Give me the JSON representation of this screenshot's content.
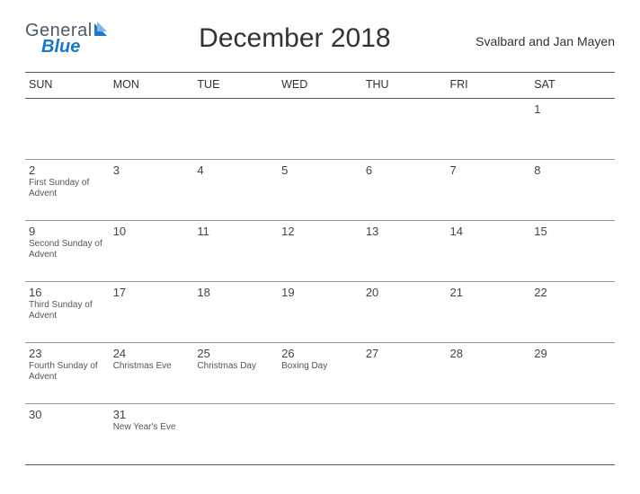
{
  "logo": {
    "word1": "General",
    "word2": "Blue"
  },
  "title": "December 2018",
  "region": "Svalbard and Jan Mayen",
  "dow": [
    "SUN",
    "MON",
    "TUE",
    "WED",
    "THU",
    "FRI",
    "SAT"
  ],
  "weeks": [
    [
      {
        "n": "",
        "e": ""
      },
      {
        "n": "",
        "e": ""
      },
      {
        "n": "",
        "e": ""
      },
      {
        "n": "",
        "e": ""
      },
      {
        "n": "",
        "e": ""
      },
      {
        "n": "",
        "e": ""
      },
      {
        "n": "1",
        "e": ""
      }
    ],
    [
      {
        "n": "2",
        "e": "First Sunday of Advent"
      },
      {
        "n": "3",
        "e": ""
      },
      {
        "n": "4",
        "e": ""
      },
      {
        "n": "5",
        "e": ""
      },
      {
        "n": "6",
        "e": ""
      },
      {
        "n": "7",
        "e": ""
      },
      {
        "n": "8",
        "e": ""
      }
    ],
    [
      {
        "n": "9",
        "e": "Second Sunday of Advent"
      },
      {
        "n": "10",
        "e": ""
      },
      {
        "n": "11",
        "e": ""
      },
      {
        "n": "12",
        "e": ""
      },
      {
        "n": "13",
        "e": ""
      },
      {
        "n": "14",
        "e": ""
      },
      {
        "n": "15",
        "e": ""
      }
    ],
    [
      {
        "n": "16",
        "e": "Third Sunday of Advent"
      },
      {
        "n": "17",
        "e": ""
      },
      {
        "n": "18",
        "e": ""
      },
      {
        "n": "19",
        "e": ""
      },
      {
        "n": "20",
        "e": ""
      },
      {
        "n": "21",
        "e": ""
      },
      {
        "n": "22",
        "e": ""
      }
    ],
    [
      {
        "n": "23",
        "e": "Fourth Sunday of Advent"
      },
      {
        "n": "24",
        "e": "Christmas Eve"
      },
      {
        "n": "25",
        "e": "Christmas Day"
      },
      {
        "n": "26",
        "e": "Boxing Day"
      },
      {
        "n": "27",
        "e": ""
      },
      {
        "n": "28",
        "e": ""
      },
      {
        "n": "29",
        "e": ""
      }
    ],
    [
      {
        "n": "30",
        "e": ""
      },
      {
        "n": "31",
        "e": "New Year's Eve"
      },
      {
        "n": "",
        "e": ""
      },
      {
        "n": "",
        "e": ""
      },
      {
        "n": "",
        "e": ""
      },
      {
        "n": "",
        "e": ""
      },
      {
        "n": "",
        "e": ""
      }
    ]
  ]
}
